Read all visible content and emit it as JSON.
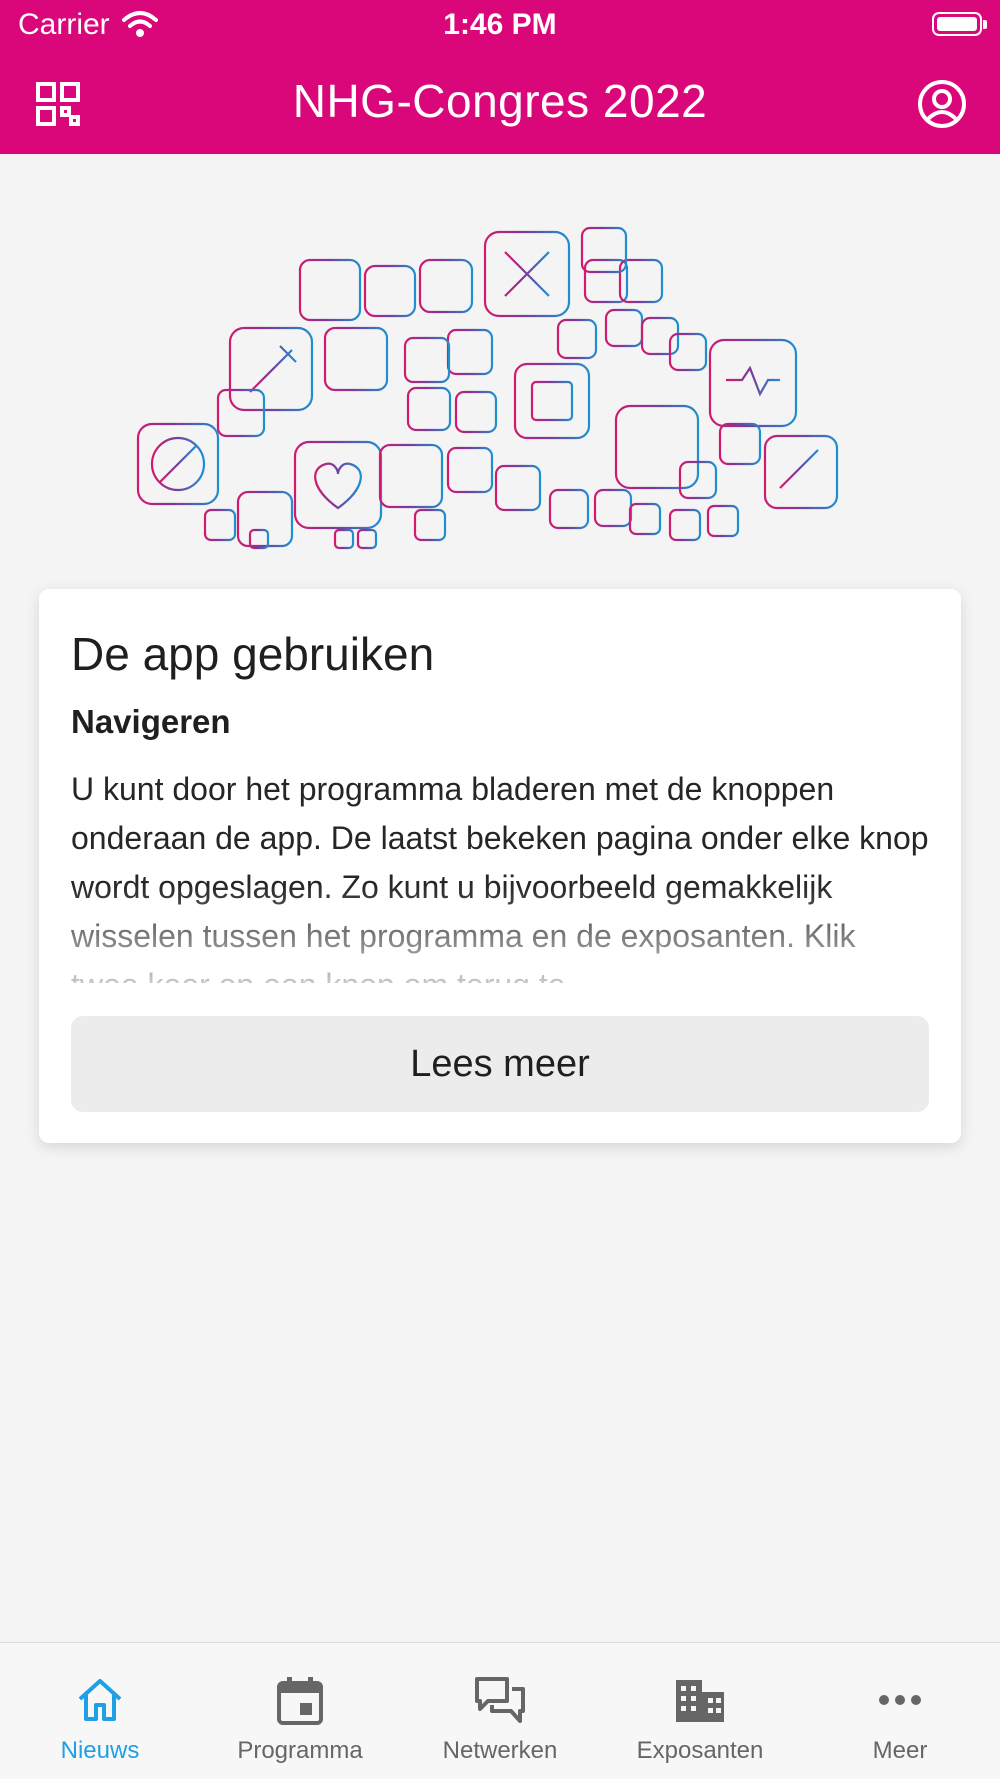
{
  "status_bar": {
    "carrier": "Carrier",
    "time": "1:46 PM"
  },
  "header": {
    "title": "NHG-Congres 2022",
    "left_icon": "qr-grid-icon",
    "right_icon": "user-circle-icon",
    "background": "#d9077a"
  },
  "card": {
    "title": "De app gebruiken",
    "subtitle": "Navigeren",
    "body": "U kunt door het programma bladeren met de knoppen onderaan de app. De laatst bekeken pagina onder elke knop wordt opgeslagen. Zo kunt u bijvoorbeeld gemakkelijk wisselen tussen het programma en de exposanten. Klik twee keer op een knop om terug te",
    "button_label": "Lees meer"
  },
  "tabs": [
    {
      "label": "Nieuws",
      "icon": "home-icon",
      "active": true
    },
    {
      "label": "Programma",
      "icon": "calendar-icon",
      "active": false
    },
    {
      "label": "Netwerken",
      "icon": "chat-bubbles-icon",
      "active": false
    },
    {
      "label": "Exposanten",
      "icon": "building-icon",
      "active": false
    },
    {
      "label": "Meer",
      "icon": "more-dots-icon",
      "active": false
    }
  ],
  "colors": {
    "brand": "#d9077a",
    "active_tab": "#1ea0e6",
    "inactive_tab": "#666666"
  }
}
